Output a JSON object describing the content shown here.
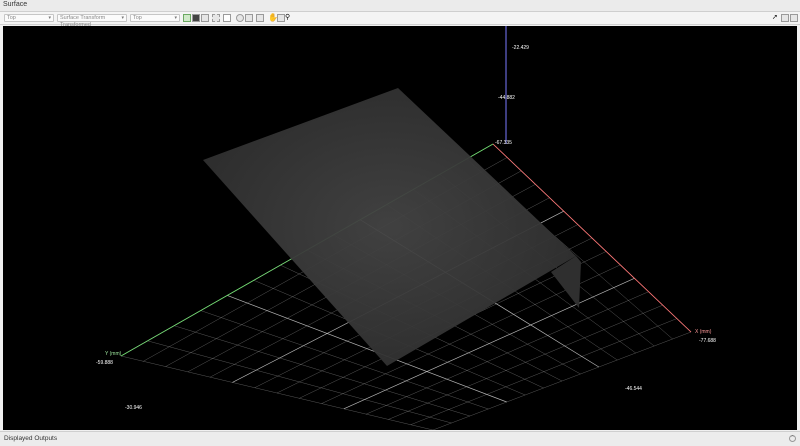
{
  "window": {
    "title": "Surface"
  },
  "toolbar": {
    "source_select": "Top",
    "data_select": "Surface Transform Transformed",
    "view_select": "Top"
  },
  "viewport": {
    "z_ticks": [
      "-22.429",
      "-44.882",
      "-67.335"
    ],
    "y_axis_label": "Y (mm)",
    "y_ticks": [
      "-59.888",
      "-30.946"
    ],
    "x_axis_label": "X (mm)",
    "x_ticks": [
      "-77.688",
      "-46.544"
    ],
    "colors": {
      "background": "#000000",
      "grid": "#c8c8c8",
      "x_axis": "#ff6b6b",
      "y_axis": "#6bdb6b",
      "z_axis": "#7a7aff",
      "surface": "#3a3a3a"
    }
  },
  "footer": {
    "title": "Displayed Outputs"
  },
  "icons": [
    "chevron-down-icon",
    "grid-view-icon",
    "layout-icon",
    "fit-view-icon",
    "window-icon",
    "snapshot-icon",
    "camera-icon",
    "pan-hand-icon",
    "zoom-box-icon",
    "search-icon",
    "arrow-pointer-icon",
    "layers-icon",
    "export-icon",
    "expand-icon"
  ]
}
